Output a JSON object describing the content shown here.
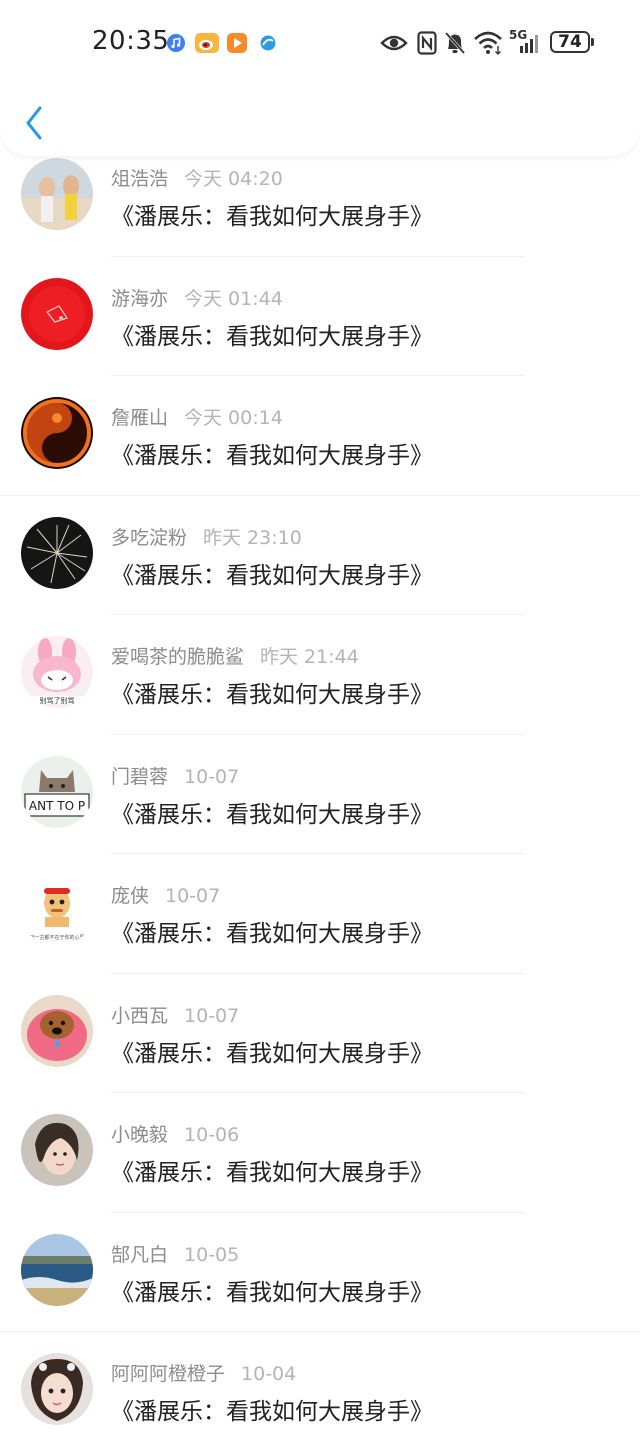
{
  "status_bar": {
    "time": "20:35",
    "network": "5G",
    "battery": "74",
    "app_icons": [
      "music-app-icon",
      "weibo-app-icon",
      "video-app-icon",
      "browser-app-icon"
    ],
    "status_icons": [
      "eye-icon",
      "nfc-icon",
      "bell-muted-icon",
      "wifi-icon",
      "signal-icon"
    ]
  },
  "header": {
    "back_icon": "chevron-left-icon",
    "accent_color": "#1a9bf0"
  },
  "comments": [
    {
      "user": "俎浩浩",
      "time": "今天 04:20",
      "content": "《潘展乐：看我如何大展身手》"
    },
    {
      "user": "游海亦",
      "time": "今天 01:44",
      "content": "《潘展乐：看我如何大展身手》"
    },
    {
      "user": "詹雁山",
      "time": "今天 00:14",
      "content": "《潘展乐：看我如何大展身手》"
    },
    {
      "user": "多吃淀粉",
      "time": "昨天 23:10",
      "content": "《潘展乐：看我如何大展身手》"
    },
    {
      "user": "爱喝茶的脆脆鲨",
      "time": "昨天 21:44",
      "content": "《潘展乐：看我如何大展身手》"
    },
    {
      "user": "门碧蓉",
      "time": "10-07",
      "content": "《潘展乐：看我如何大展身手》"
    },
    {
      "user": "庞侠",
      "time": "10-07",
      "content": "《潘展乐：看我如何大展身手》"
    },
    {
      "user": "小西瓦",
      "time": "10-07",
      "content": "《潘展乐：看我如何大展身手》"
    },
    {
      "user": "小晚毅",
      "time": "10-06",
      "content": "《潘展乐：看我如何大展身手》"
    },
    {
      "user": "郜凡白",
      "time": "10-05",
      "content": "《潘展乐：看我如何大展身手》"
    },
    {
      "user": "阿阿阿橙橙子",
      "time": "10-04",
      "content": "《潘展乐：看我如何大展身手》"
    }
  ]
}
